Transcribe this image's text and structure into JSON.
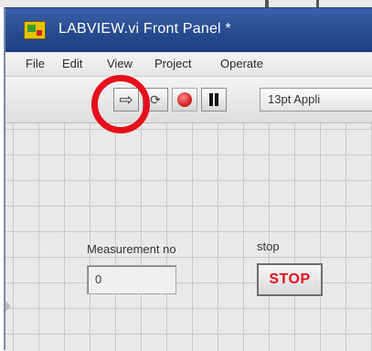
{
  "window": {
    "title": "LABVIEW.vi Front Panel *",
    "app_icon": "labview-vi-icon"
  },
  "menu": [
    {
      "label": "File"
    },
    {
      "label": "Edit"
    },
    {
      "label": "View"
    },
    {
      "label": "Project"
    },
    {
      "label": "Operate"
    }
  ],
  "toolbar": {
    "run_icon": "run-arrow-icon",
    "run_continuously_icon": "run-continuously-icon",
    "abort_icon": "abort-execution-icon",
    "pause_icon": "pause-icon",
    "font_select": "13pt Appli"
  },
  "panel": {
    "measurement_label": "Measurement no",
    "measurement_value": "0",
    "stop_label": "stop",
    "stop_button_text": "STOP"
  },
  "colors": {
    "titlebar": "#2a4e93",
    "highlight_ring": "#e5101b",
    "stop_text": "#e0131e"
  }
}
